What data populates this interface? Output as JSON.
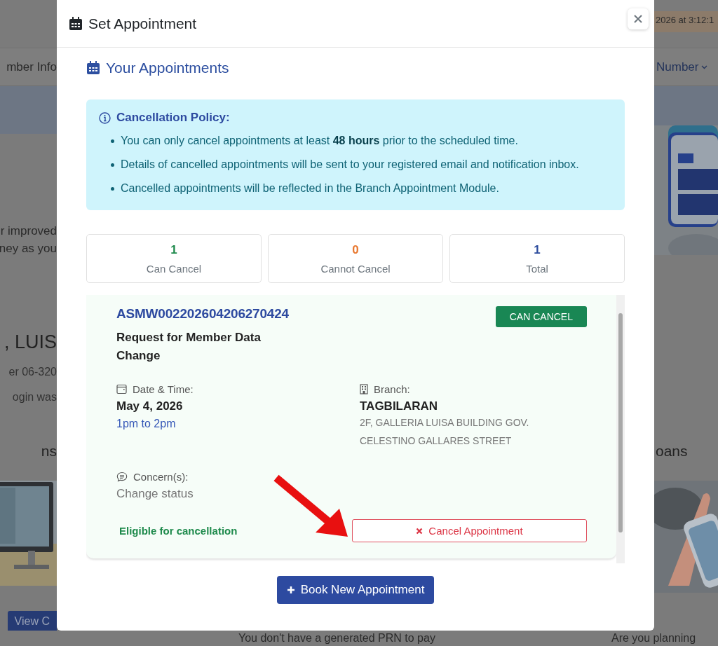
{
  "background": {
    "date_banner": "2026 at 3:12:1",
    "nav_left": "mber Info",
    "nav_right": "Number",
    "intro_lines": [
      "r improved",
      "ney as you"
    ],
    "member_name": ", LUIS",
    "member_line": "er 06-320",
    "login_line": "ogin was",
    "section_left": "ns",
    "section_right": "oans",
    "view_button": "View C",
    "footer_left": "You don't have a generated PRN to pay",
    "footer_right": "Are you planning"
  },
  "modal": {
    "title": "Set Appointment",
    "section_title": "Your Appointments",
    "policy": {
      "title": "Cancellation Policy:",
      "items": [
        "You can only cancel appointments at least **48 hours** prior to the scheduled time.",
        "Details of cancelled appointments will be sent to your registered email and notification inbox.",
        "Cancelled appointments will be reflected in the Branch Appointment Module."
      ]
    },
    "stats": [
      {
        "kind": "can",
        "value": "1",
        "label": "Can Cancel"
      },
      {
        "kind": "cannot",
        "value": "0",
        "label": "Cannot Cancel"
      },
      {
        "kind": "total",
        "value": "1",
        "label": "Total"
      }
    ],
    "appointments": [
      {
        "reference": "ASMW002202604206270424",
        "service": "Request for Member Data Change",
        "status_badge": "CAN CANCEL",
        "can_cancel": true,
        "date_label": "Date & Time:",
        "date": "May 4, 2026",
        "time": "1pm to 2pm",
        "branch_label": "Branch:",
        "branch": "TAGBILARAN",
        "address": "2F, GALLERIA LUISA BUILDING GOV. CELESTINO GALLARES STREET",
        "concern_label": "Concern(s):",
        "concern": "Change status",
        "eligibility": "Eligible for cancellation",
        "cancel_button": "Cancel Appointment"
      }
    ],
    "book_button": "Book New Appointment"
  }
}
